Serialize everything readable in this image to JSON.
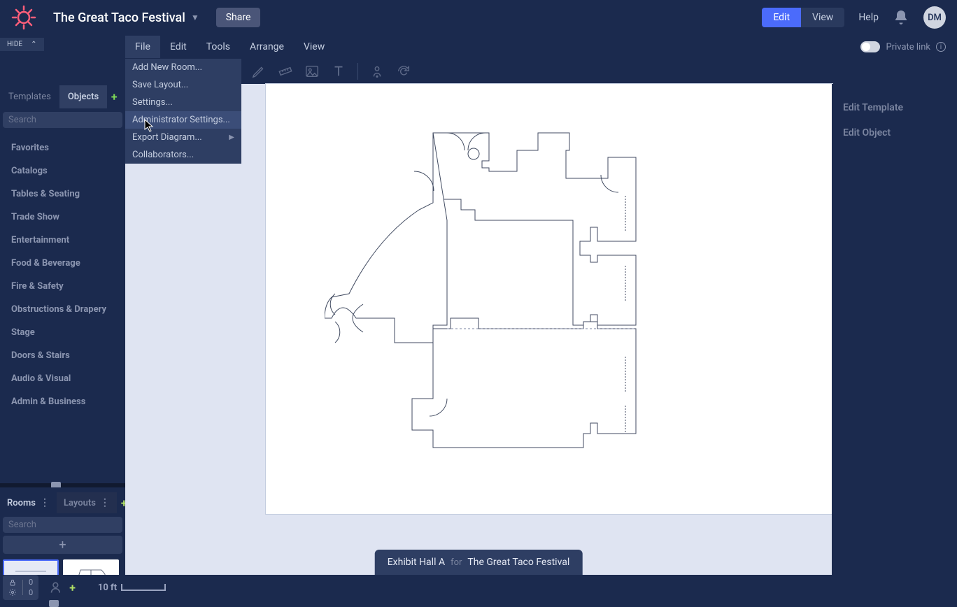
{
  "header": {
    "project_title": "The Great Taco Festival",
    "share": "Share",
    "mode_edit": "Edit",
    "mode_view": "View",
    "help": "Help",
    "avatar": "DM"
  },
  "hide_tab": "HIDE",
  "menubar": {
    "items": [
      "File",
      "Edit",
      "Tools",
      "Arrange",
      "View"
    ],
    "private_link": "Private link"
  },
  "file_dropdown": [
    "Add New Room...",
    "Save Layout...",
    "Settings...",
    "Administrator Settings...",
    "Export Diagram...",
    "Collaborators..."
  ],
  "sidebar": {
    "tabs": {
      "templates": "Templates",
      "objects": "Objects"
    },
    "search_placeholder": "Search",
    "categories": [
      "Favorites",
      "Catalogs",
      "Tables & Seating",
      "Trade Show",
      "Entertainment",
      "Food & Beverage",
      "Fire & Safety",
      "Obstructions & Drapery",
      "Stage",
      "Doors & Stairs",
      "Audio & Visual",
      "Admin & Business"
    ]
  },
  "rooms_panel": {
    "rooms_tab": "Rooms",
    "layouts_tab": "Layouts",
    "search_placeholder": "Search"
  },
  "bottom": {
    "lock_count": "0",
    "gear_count": "0",
    "scale": "10 ft"
  },
  "room_pill": {
    "room": "Exhibit Hall A",
    "for": "for",
    "event": "The Great Taco Festival"
  },
  "right": {
    "edit_template": "Edit Template",
    "edit_object": "Edit Object"
  }
}
